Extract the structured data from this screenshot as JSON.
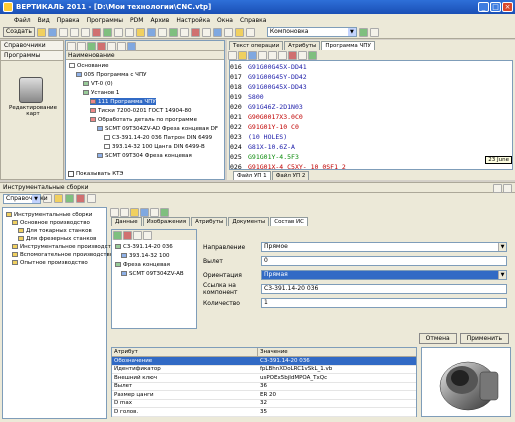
{
  "window": {
    "title": "ВЕРТИКАЛЬ 2011 - [D:\\Мои технологии\\CNC.vtp]"
  },
  "menu": [
    "Файл",
    "Вид",
    "Правка",
    "Программы",
    "PDM",
    "Архив",
    "Настройка",
    "Окна",
    "Справка"
  ],
  "toolbar": {
    "create_label": "Создать",
    "component_label": "Компоновка"
  },
  "left_panel": {
    "tabs": [
      "Справочники",
      "Программы"
    ],
    "item_label": "Редактирование карт"
  },
  "tree": {
    "header": "Наименование",
    "items": [
      {
        "label": "Основание",
        "level": 0
      },
      {
        "label": "005 Программа с ЧПУ",
        "level": 1
      },
      {
        "label": "VT-0 (0)",
        "level": 2
      },
      {
        "label": "Установ 1",
        "level": 2
      },
      {
        "label": "111 Программа ЧПУ",
        "level": 3,
        "selected": true
      },
      {
        "label": "Тиски 7200-0201 ГОСТ 14904-80",
        "level": 3
      },
      {
        "label": "Обработать деталь по программе",
        "level": 3
      },
      {
        "label": "SCMT 09T304ZV-AD Фреза концевая DF",
        "level": 4
      },
      {
        "label": "C3-391.14-20 036 Патрон DIN 6499",
        "level": 5
      },
      {
        "label": "393.14-32 100 Цанга DIN 6499-B",
        "level": 5
      },
      {
        "label": "SCMT 09T304 Фреза концевая",
        "level": 4
      }
    ],
    "footer_checkbox": "Показывать КТЭ"
  },
  "editor": {
    "tabs": [
      "Текст операции",
      "Атрибуты",
      "Программа ЧПУ"
    ],
    "lines": [
      {
        "n": "016",
        "t": "G91G00G45X-DD41",
        "c": "blue"
      },
      {
        "n": "017",
        "t": "G91G00G45Y-DD42",
        "c": "blue"
      },
      {
        "n": "018",
        "t": "G91G00G45X-DD43",
        "c": "blue"
      },
      {
        "n": "019",
        "t": "S800",
        "c": "blue"
      },
      {
        "n": "020",
        "t": "G91G46Z-2D1N03",
        "c": "blue"
      },
      {
        "n": "021",
        "t": "G90G0017X3.0C0",
        "c": "red"
      },
      {
        "n": "022",
        "t": "G91G01Y-10 C0",
        "c": "red"
      },
      {
        "n": "023",
        "t": "(10 HOLES)",
        "c": "blue"
      },
      {
        "n": "024",
        "t": "G81X-10.6Z-A",
        "c": "blue"
      },
      {
        "n": "025",
        "t": "G91G01Y-4.5F3",
        "c": "gr"
      },
      {
        "n": "026",
        "t": "G91G01X-4 C5XY- 10 0SF1 2",
        "c": "red"
      }
    ],
    "tooltip": "23 June",
    "file_tabs": [
      "Файл УП 1",
      "Файл УП 2"
    ]
  },
  "assemblies": {
    "title": "Инструментальные сборки",
    "toolbar_label": "Справочники",
    "tree": [
      {
        "label": "Инструментальные сборки",
        "level": 0
      },
      {
        "label": "Основное производство",
        "level": 1
      },
      {
        "label": "Для токарных станков",
        "level": 2
      },
      {
        "label": "Для фрезерных станков",
        "level": 2
      },
      {
        "label": "Инструментальное производство",
        "level": 1
      },
      {
        "label": "Вспомогательное производство",
        "level": 1
      },
      {
        "label": "Опытное производство",
        "level": 1
      }
    ],
    "tabs": [
      "Данные",
      "Изображения",
      "Атрибуты",
      "Документы",
      "Состав ИС"
    ],
    "components": [
      {
        "label": "C3-391.14-20 036",
        "level": 0
      },
      {
        "label": "393.14-32 100",
        "level": 1
      },
      {
        "label": "Фреза концевая",
        "level": 0
      },
      {
        "label": "SCMT 09T304ZV-AB",
        "level": 1
      }
    ],
    "form": [
      {
        "label": "Направление",
        "value": "Прямое",
        "type": "combo"
      },
      {
        "label": "Вылет",
        "value": "0",
        "type": "field"
      },
      {
        "label": "Ориентация",
        "value": "Прямая",
        "type": "combo",
        "selected": true
      },
      {
        "label": "Ссылка на компонент",
        "value": "C3-391.14-20 036",
        "type": "field"
      },
      {
        "label": "Количество",
        "value": "1",
        "type": "field"
      }
    ],
    "buttons": {
      "cancel": "Отмена",
      "apply": "Применить"
    },
    "attr_table": {
      "headers": [
        "Атрибут",
        "Значение"
      ],
      "rows": [
        [
          "Обозначение",
          "C3-391.14-20 036",
          true
        ],
        [
          "Идентификатор",
          "fpLBhnXDoLRC1vSkL_1.vb",
          false
        ],
        [
          "Внешний ключ",
          "usPOEx5bjIdMPOA_TxQc",
          false
        ],
        [
          "Вылет",
          "36",
          false
        ],
        [
          "Размер цанги",
          "ER 20",
          false
        ],
        [
          "D max",
          "32",
          false
        ],
        [
          "D голов.",
          "35",
          false
        ]
      ]
    }
  }
}
